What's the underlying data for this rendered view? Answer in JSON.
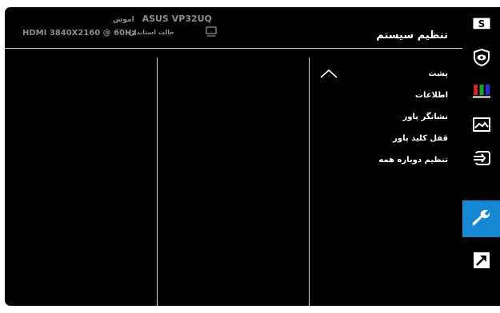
{
  "header": {
    "title": "تنظیم سیستم",
    "mode_label": "اموش",
    "brand": "ASUS VP32UQ",
    "standard_mode": "حالت استاندارد",
    "signal": "HDMI 3840X2160 @ 60Hz"
  },
  "menu": {
    "items": [
      {
        "label": "پشت"
      },
      {
        "label": "اطلاعات"
      },
      {
        "label": "نشانگر پاور"
      },
      {
        "label": "قفل کلید پاور"
      },
      {
        "label": "تنظیم دوباره همه"
      }
    ]
  },
  "sidebar": {
    "items": [
      {
        "icon": "splendid-s-icon",
        "label": "S"
      },
      {
        "icon": "eye-care-icon"
      },
      {
        "icon": "color-bars-icon"
      },
      {
        "icon": "image-icon"
      },
      {
        "icon": "input-select-icon"
      },
      {
        "icon": "wrench-icon",
        "active": true
      },
      {
        "icon": "shortcut-arrow-icon"
      }
    ],
    "active_color": "#1788d3"
  }
}
